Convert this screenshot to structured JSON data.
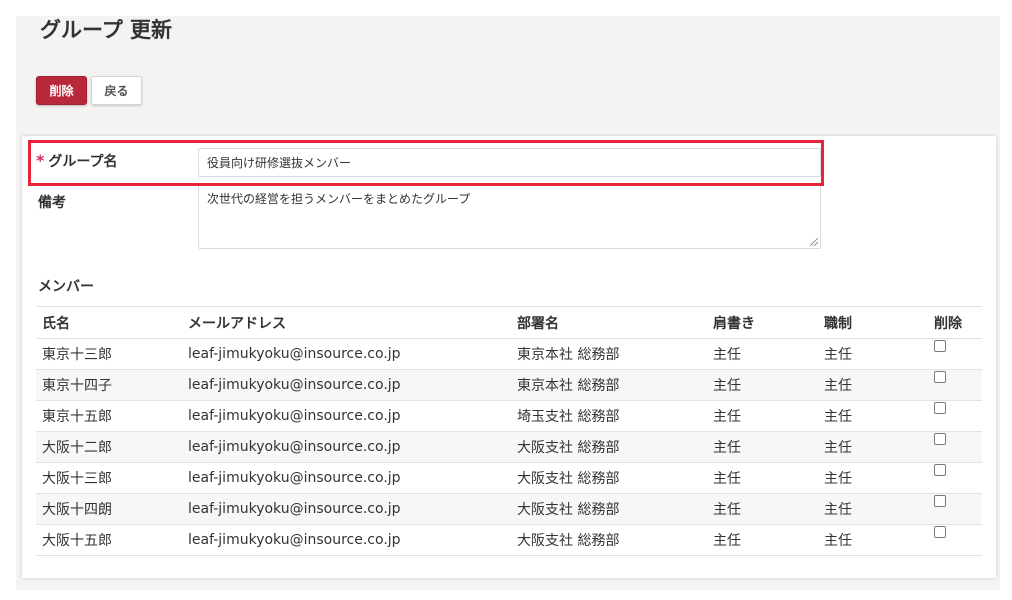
{
  "page": {
    "title": "グループ 更新"
  },
  "toolbar": {
    "delete_label": "削除",
    "back_label": "戻る"
  },
  "form": {
    "group_name_required_mark": "*",
    "group_name_label": "グループ名",
    "group_name_value": "役員向け研修選抜メンバー",
    "notes_label": "備考",
    "notes_value": "次世代の経営を担うメンバーをまとめたグループ"
  },
  "members": {
    "section_title": "メンバー",
    "columns": [
      "氏名",
      "メールアドレス",
      "部署名",
      "肩書き",
      "職制",
      "削除"
    ],
    "rows": [
      {
        "name": "東京十三郎",
        "email": "leaf-jimukyoku@insource.co.jp",
        "dept": "東京本社 総務部",
        "title": "主任",
        "position": "主任"
      },
      {
        "name": "東京十四子",
        "email": "leaf-jimukyoku@insource.co.jp",
        "dept": "東京本社 総務部",
        "title": "主任",
        "position": "主任"
      },
      {
        "name": "東京十五郎",
        "email": "leaf-jimukyoku@insource.co.jp",
        "dept": "埼玉支社 総務部",
        "title": "主任",
        "position": "主任"
      },
      {
        "name": "大阪十二郎",
        "email": "leaf-jimukyoku@insource.co.jp",
        "dept": "大阪支社 総務部",
        "title": "主任",
        "position": "主任"
      },
      {
        "name": "大阪十三郎",
        "email": "leaf-jimukyoku@insource.co.jp",
        "dept": "大阪支社 総務部",
        "title": "主任",
        "position": "主任"
      },
      {
        "name": "大阪十四朗",
        "email": "leaf-jimukyoku@insource.co.jp",
        "dept": "大阪支社 総務部",
        "title": "主任",
        "position": "主任"
      },
      {
        "name": "大阪十五郎",
        "email": "leaf-jimukyoku@insource.co.jp",
        "dept": "大阪支社 総務部",
        "title": "主任",
        "position": "主任"
      }
    ]
  },
  "colors": {
    "danger": "#b8283b",
    "highlight": "#e8243b",
    "required": "#d6295a"
  }
}
